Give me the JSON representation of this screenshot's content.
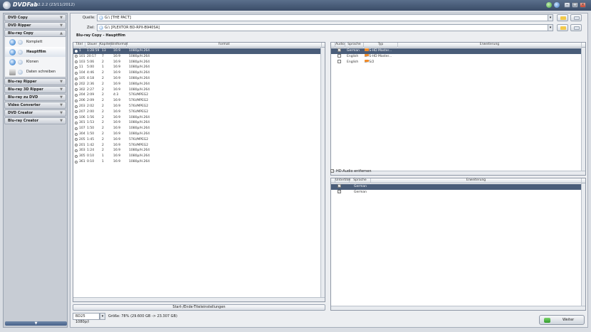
{
  "app": {
    "name": "DVDFab",
    "version": "8.2.2.2 (23/11/2012)"
  },
  "sidebar": {
    "sections": [
      {
        "label": "DVD Copy"
      },
      {
        "label": "DVD Ripper"
      },
      {
        "label": "Blu-ray Copy"
      },
      {
        "label": "Blu-ray Ripper"
      },
      {
        "label": "Blu-ray 3D Ripper"
      },
      {
        "label": "Blu-ray zu DVD"
      },
      {
        "label": "Video Converter"
      },
      {
        "label": "DVD Creator"
      },
      {
        "label": "Blu-ray Creator"
      }
    ],
    "bluray_copy_items": [
      {
        "label": "Komplett"
      },
      {
        "label": "Hauptfilm"
      },
      {
        "label": "Klonen"
      },
      {
        "label": "Daten schreiben"
      }
    ]
  },
  "source": {
    "label": "Quelle:",
    "value": "G:\\ [THE PACT]"
  },
  "target": {
    "label": "Ziel:",
    "value": "G:\\ [PLEXTOR BD-RPX-B940SA]"
  },
  "breadcrumb": "Blu-ray Copy  -  Hauptfilm",
  "titles": {
    "headers": {
      "title": "Titel",
      "duration": "Dauer",
      "chapters": "Kapitel",
      "aspect": "Bildformat",
      "format": "Format"
    },
    "rows": [
      {
        "title": "1",
        "duration": "1:28:59",
        "chapters": "13",
        "aspect": "16:9",
        "format": "1080p/H.264"
      },
      {
        "title": "101",
        "duration": "20:17",
        "chapters": "7",
        "aspect": "16:9",
        "format": "1080p/H.264"
      },
      {
        "title": "103",
        "duration": "5:06",
        "chapters": "2",
        "aspect": "16:9",
        "format": "1080p/H.264"
      },
      {
        "title": "11",
        "duration": "5:00",
        "chapters": "1",
        "aspect": "16:9",
        "format": "1080p/H.264"
      },
      {
        "title": "104",
        "duration": "4:46",
        "chapters": "2",
        "aspect": "16:9",
        "format": "1080p/H.264"
      },
      {
        "title": "105",
        "duration": "4:18",
        "chapters": "2",
        "aspect": "16:9",
        "format": "1080p/H.264"
      },
      {
        "title": "202",
        "chapters": "2",
        "duration": "2:36",
        "aspect": "16:9",
        "format": "1080p/H.264"
      },
      {
        "title": "302",
        "duration": "2:27",
        "chapters": "2",
        "aspect": "16:9",
        "format": "1080p/H.264"
      },
      {
        "title": "204",
        "duration": "2:09",
        "chapters": "2",
        "aspect": "4:3",
        "format": "576i/MPEG2"
      },
      {
        "title": "206",
        "duration": "2:09",
        "chapters": "2",
        "aspect": "16:9",
        "format": "576i/MPEG2"
      },
      {
        "title": "203",
        "duration": "2:02",
        "chapters": "2",
        "aspect": "16:9",
        "format": "576i/MPEG2"
      },
      {
        "title": "207",
        "duration": "2:00",
        "chapters": "2",
        "aspect": "16:9",
        "format": "576i/MPEG2"
      },
      {
        "title": "106",
        "duration": "1:56",
        "chapters": "2",
        "aspect": "16:9",
        "format": "1080p/H.264"
      },
      {
        "title": "301",
        "duration": "1:53",
        "chapters": "2",
        "aspect": "16:9",
        "format": "1080p/H.264"
      },
      {
        "title": "107",
        "duration": "1:50",
        "chapters": "2",
        "aspect": "16:9",
        "format": "1080p/H.264"
      },
      {
        "title": "304",
        "duration": "1:50",
        "chapters": "2",
        "aspect": "16:9",
        "format": "1080p/H.264"
      },
      {
        "title": "205",
        "duration": "1:45",
        "chapters": "2",
        "aspect": "16:9",
        "format": "576i/MPEG2"
      },
      {
        "title": "201",
        "duration": "1:42",
        "chapters": "2",
        "aspect": "16:9",
        "format": "576i/MPEG2"
      },
      {
        "title": "303",
        "duration": "1:24",
        "chapters": "2",
        "aspect": "16:9",
        "format": "1080p/H.264"
      },
      {
        "title": "305",
        "duration": "0:10",
        "chapters": "1",
        "aspect": "16:9",
        "format": "1080p/H.264"
      },
      {
        "title": "361",
        "duration": "0:10",
        "chapters": "1",
        "aspect": "16:9",
        "format": "1080p/H.264"
      }
    ]
  },
  "audio": {
    "headers": {
      "audio": "Audio",
      "language": "Sprache",
      "type": "Typ",
      "extension": "Erweiterung"
    },
    "rows": [
      {
        "language": "German",
        "type": "DTS-HD Master...",
        "checked": true
      },
      {
        "language": "English",
        "type": "DTS-HD Master...",
        "checked": false
      },
      {
        "language": "English",
        "type": "DTS/2",
        "checked": false
      }
    ]
  },
  "hd_audio_option": {
    "label": "HD-Audio entfernen",
    "checked": true
  },
  "subtitles": {
    "headers": {
      "subtitle": "Untertitel",
      "language": "Sprache",
      "extension": "Erweiterung"
    },
    "rows": [
      {
        "language": "German",
        "checked": true
      },
      {
        "language": "German",
        "checked": true
      }
    ]
  },
  "start_end_button": "Start-/Ende-Titeleinstellungen",
  "output": {
    "format": "BD25 1080p/i",
    "size_text": "Größe: 78% (29.600 GB -> 23.307 GB)"
  },
  "next_button": "Weiter",
  "colors": {
    "selection": "#4a5d79",
    "titlebar": "#3b4d68",
    "accent_orange": "#f28c28"
  }
}
